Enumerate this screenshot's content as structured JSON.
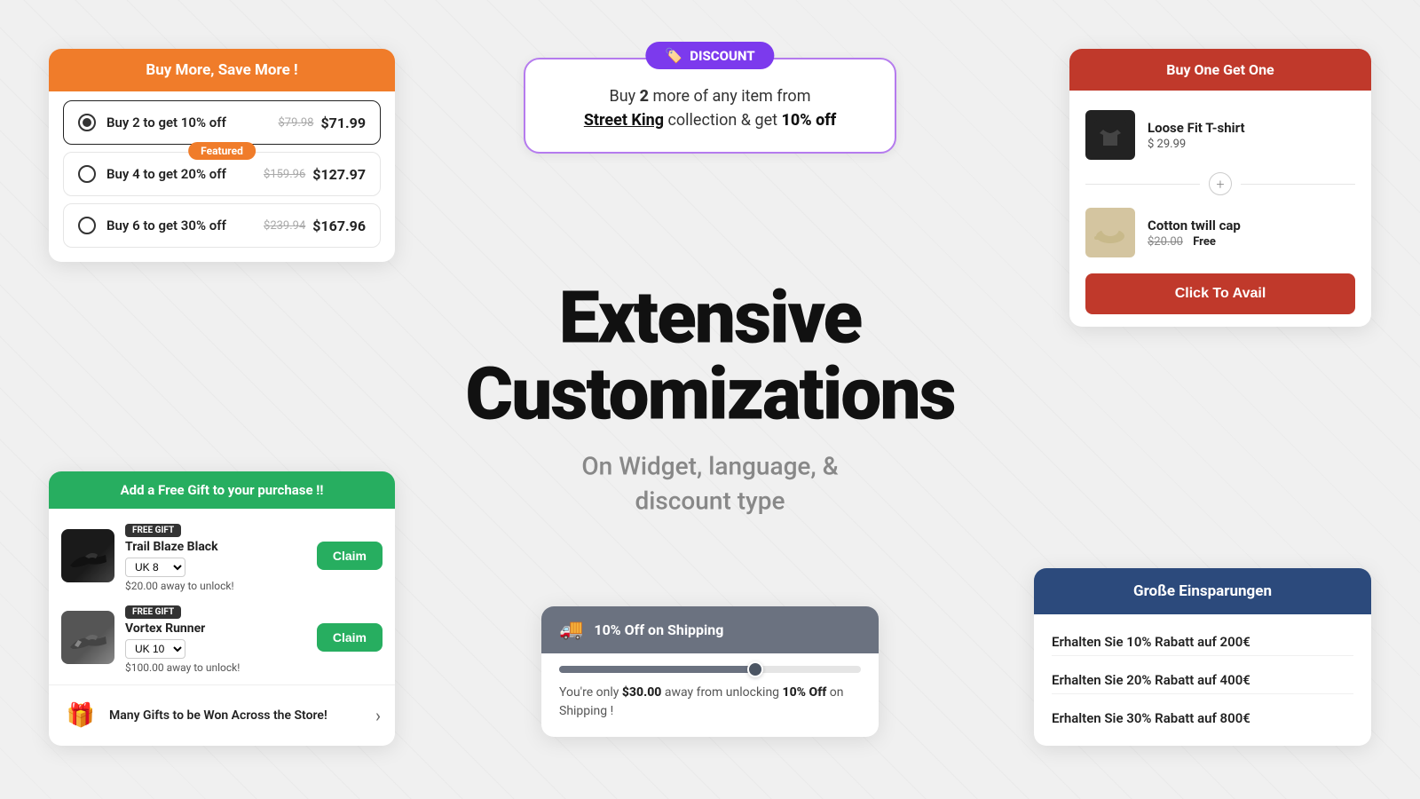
{
  "hero": {
    "title": "Extensive Customizations",
    "subtitle": "On Widget, language, &\ndiscount type"
  },
  "widget_buy_more": {
    "header": "Buy More, Save More !",
    "options": [
      {
        "label": "Buy 2 to get 10% off",
        "original_price": "$79.98",
        "discounted_price": "$71.99",
        "selected": true,
        "featured": false
      },
      {
        "label": "Buy 4 to get 20% off",
        "original_price": "$159.96",
        "discounted_price": "$127.97",
        "selected": false,
        "featured": true,
        "featured_label": "Featured"
      },
      {
        "label": "Buy 6 to get 30% off",
        "original_price": "$239.94",
        "discounted_price": "$167.96",
        "selected": false,
        "featured": false
      }
    ]
  },
  "widget_discount": {
    "badge_label": "DISCOUNT",
    "text_pre": "Buy ",
    "text_qty": "2",
    "text_mid": " more of any item from",
    "text_collection": "Street King",
    "text_post": " collection & get ",
    "text_discount": "10% off"
  },
  "widget_bogo": {
    "header": "Buy One Get One",
    "item1": {
      "name": "Loose Fit T-shirt",
      "price": "$ 29.99"
    },
    "item2": {
      "name": "Cotton twill cap",
      "original_price": "$20.00",
      "free_label": "Free"
    },
    "avail_button": "Click To Avail"
  },
  "widget_free_gift": {
    "header": "Add a Free Gift to your purchase !!",
    "items": [
      {
        "free_badge": "FREE GIFT",
        "name": "Trail Blaze Black",
        "variant": "UK 8",
        "unlock_text": "$20.00 away to unlock!",
        "claim_label": "Claim"
      },
      {
        "free_badge": "FREE GIFT",
        "name": "Vortex Runner",
        "variant": "UK 10",
        "unlock_text": "$100.00 away to unlock!",
        "claim_label": "Claim"
      }
    ],
    "footer_text": "Many Gifts to be Won Across the Store!"
  },
  "widget_shipping": {
    "title": "10% Off on Shipping",
    "progress_percent": 65,
    "desc_pre": "You're only ",
    "desc_amount": "$30.00",
    "desc_mid": " away from unlocking ",
    "desc_discount": "10% Off",
    "desc_post": " on Shipping !"
  },
  "widget_german": {
    "header": "Große Einsparungen",
    "options": [
      "Erhalten Sie 10% Rabatt auf 200€",
      "Erhalten Sie 20% Rabatt auf 400€",
      "Erhalten Sie 30% Rabatt auf 800€"
    ]
  }
}
